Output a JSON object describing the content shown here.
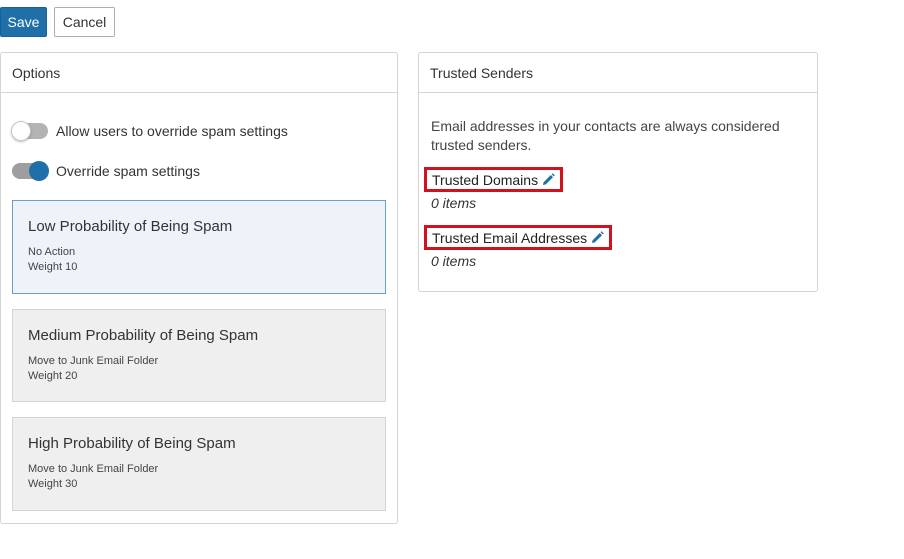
{
  "toolbar": {
    "save_label": "Save",
    "cancel_label": "Cancel"
  },
  "options": {
    "title": "Options",
    "toggles": [
      {
        "label": "Allow users to override spam settings",
        "state": "off"
      },
      {
        "label": "Override spam settings",
        "state": "on"
      }
    ],
    "cards": [
      {
        "title": "Low Probability of Being Spam",
        "action": "No Action",
        "weight": "Weight 10",
        "selected": true
      },
      {
        "title": "Medium Probability of Being Spam",
        "action": "Move to Junk Email Folder",
        "weight": "Weight 20",
        "selected": false
      },
      {
        "title": "High Probability of Being Spam",
        "action": "Move to Junk Email Folder",
        "weight": "Weight 30",
        "selected": false
      }
    ]
  },
  "trusted_senders": {
    "title": "Trusted Senders",
    "description": "Email addresses in your contacts are always considered trusted senders.",
    "domains_label": "Trusted Domains",
    "domains_count": "0 items",
    "emails_label": "Trusted Email Addresses",
    "emails_count": "0 items",
    "edit_icon": "pencil-icon"
  },
  "colors": {
    "accent": "#1f6fa8",
    "highlight_border": "#d0121e"
  }
}
